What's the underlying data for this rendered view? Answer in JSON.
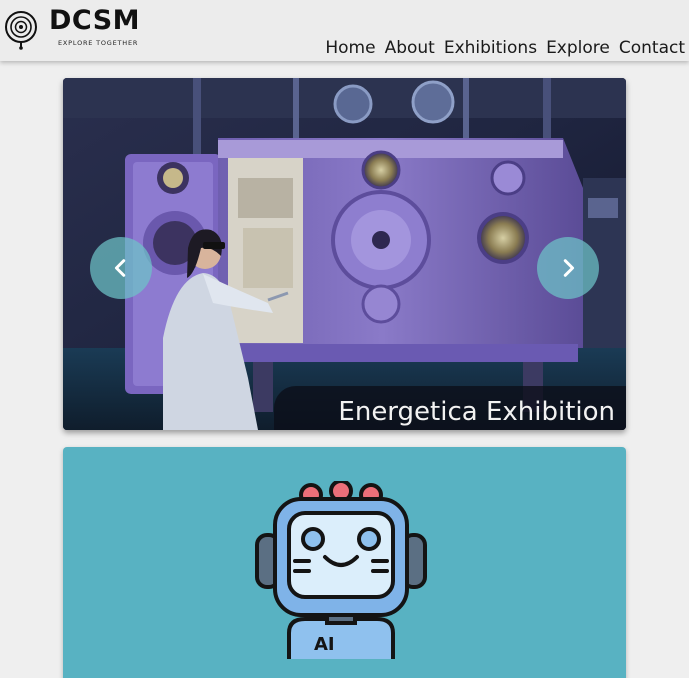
{
  "brand": {
    "name": "DCSM",
    "tagline": "EXPLORE TOGETHER"
  },
  "nav": {
    "items": [
      {
        "label": "Home"
      },
      {
        "label": "About"
      },
      {
        "label": "Exhibitions"
      },
      {
        "label": "Explore"
      },
      {
        "label": "Contact"
      }
    ]
  },
  "carousel": {
    "caption": "Energetica Exhibition",
    "prev_icon": "chevron-left-icon",
    "next_icon": "chevron-right-icon"
  },
  "card": {
    "image_label": "AI"
  },
  "colors": {
    "header_bg": "#ececec",
    "page_bg": "#efefef",
    "card_bg": "#58b2c2",
    "arrow_bg": "#6ec4c8",
    "caption_bg": "#0c0e18"
  }
}
